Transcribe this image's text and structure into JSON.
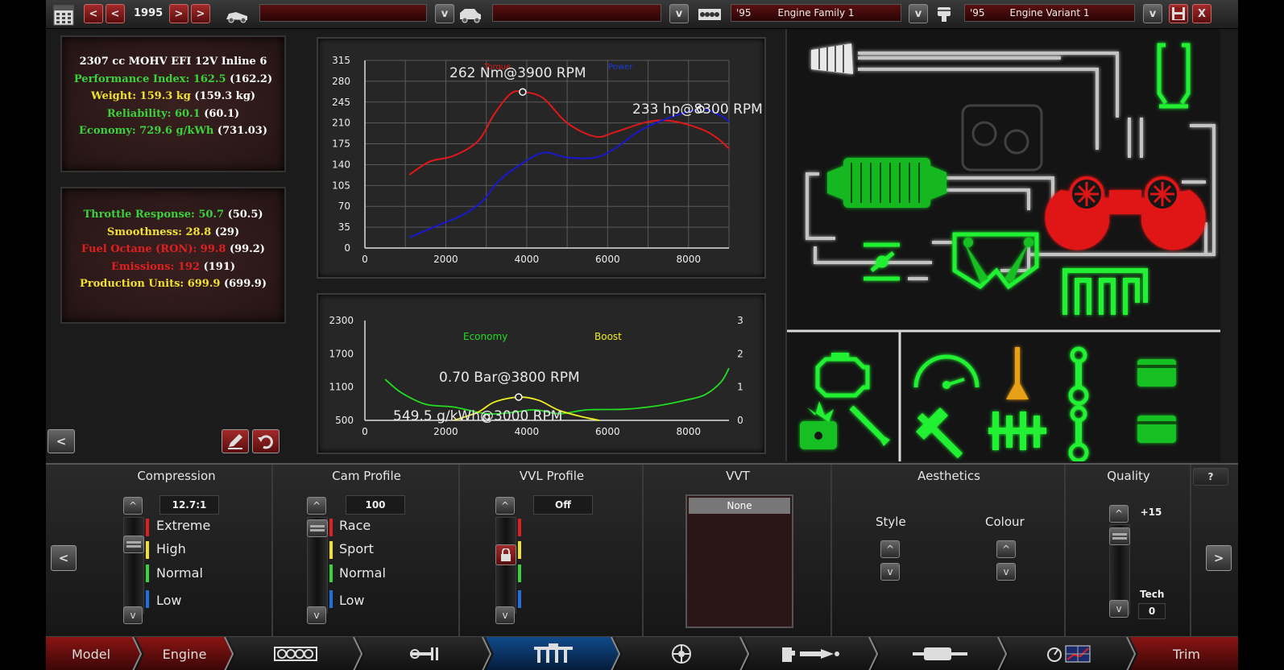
{
  "topbar": {
    "year": "1995",
    "prev_fast": "<",
    "prev": "<",
    "next": ">",
    "next_fast": ">",
    "dropdown_arrow": "v",
    "family": {
      "year": "'95",
      "name": "Engine Family 1"
    },
    "variant": {
      "year": "'95",
      "name": "Engine Variant 1"
    },
    "close": "X"
  },
  "stats_top": {
    "engine": "2307 cc MOHV EFI 12V Inline 6",
    "lines": [
      {
        "label": "Performance Index: 162.5",
        "paren": "(162.2)",
        "color": "#3cd23c"
      },
      {
        "label": "Weight: 159.3 kg",
        "paren": "(159.3 kg)",
        "color": "#f0e030"
      },
      {
        "label": "Reliability: 60.1",
        "paren": "(60.1)",
        "color": "#3cd23c"
      },
      {
        "label": "Economy: 729.6 g/kWh",
        "paren": "(731.03)",
        "color": "#3cd23c"
      }
    ]
  },
  "stats_bottom": {
    "lines": [
      {
        "label": "Throttle Response: 50.7",
        "paren": "(50.5)",
        "color": "#3cd23c"
      },
      {
        "label": "Smoothness: 28.8",
        "paren": "(29)",
        "color": "#f0e030"
      },
      {
        "label": "Fuel Octane (RON): 99.8",
        "paren": "(99.2)",
        "color": "#e02020"
      },
      {
        "label": "Emissions: 192",
        "paren": "(191)",
        "color": "#e02020"
      },
      {
        "label": "Production Units: 699.9",
        "paren": "(699.9)",
        "color": "#f0e030"
      }
    ]
  },
  "left_buttons": {
    "back": "<"
  },
  "chart_data": [
    {
      "type": "line",
      "legend": [
        "Torque",
        "Power"
      ],
      "annotations": [
        "262 Nm@3900 RPM",
        "233 hp@8300 RPM"
      ],
      "x_ticks": [
        "0",
        "2000",
        "4000",
        "6000",
        "8000"
      ],
      "y_ticks": [
        "0",
        "35",
        "70",
        "105",
        "140",
        "175",
        "210",
        "245",
        "280",
        "315"
      ],
      "xlim": [
        0,
        9000
      ],
      "ylim": [
        0,
        315
      ],
      "grid": true,
      "series": [
        {
          "name": "Torque",
          "color": "#e01818",
          "points": [
            [
              1100,
              123
            ],
            [
              1600,
              145
            ],
            [
              2200,
              155
            ],
            [
              2800,
              180
            ],
            [
              3200,
              225
            ],
            [
              3600,
              259
            ],
            [
              3900,
              262
            ],
            [
              4400,
              252
            ],
            [
              5000,
              210
            ],
            [
              5700,
              187
            ],
            [
              6200,
              195
            ],
            [
              7000,
              212
            ],
            [
              7600,
              213
            ],
            [
              8300,
              200
            ],
            [
              8700,
              185
            ],
            [
              9000,
              167
            ]
          ]
        },
        {
          "name": "Power",
          "color": "#1818d0",
          "points": [
            [
              1100,
              18
            ],
            [
              1700,
              35
            ],
            [
              2400,
              55
            ],
            [
              2900,
              78
            ],
            [
              3300,
              112
            ],
            [
              3800,
              138
            ],
            [
              4400,
              160
            ],
            [
              5000,
              152
            ],
            [
              5700,
              152
            ],
            [
              6200,
              168
            ],
            [
              6800,
              197
            ],
            [
              7500,
              218
            ],
            [
              8300,
              233
            ],
            [
              8800,
              222
            ],
            [
              9000,
              212
            ]
          ]
        }
      ]
    },
    {
      "type": "line",
      "legend": [
        "Economy",
        "Boost"
      ],
      "annotations": [
        "0.70 Bar@3800 RPM",
        "549.5 g/kWh@3000 RPM"
      ],
      "x_ticks": [
        "0",
        "2000",
        "4000",
        "6000",
        "8000"
      ],
      "y_ticks_left": [
        "500",
        "1100",
        "1700",
        "2300"
      ],
      "y_ticks_right": [
        "0",
        "1",
        "2",
        "3"
      ],
      "xlim": [
        0,
        9000
      ],
      "ylim_left": [
        500,
        2300
      ],
      "ylim_right": [
        0,
        3
      ],
      "grid": false,
      "series": [
        {
          "name": "Economy",
          "color": "#22dd22",
          "axis": "left",
          "points": [
            [
              500,
              1240
            ],
            [
              900,
              1000
            ],
            [
              1500,
              790
            ],
            [
              2200,
              740
            ],
            [
              3000,
              620
            ],
            [
              3600,
              640
            ],
            [
              4200,
              690
            ],
            [
              4800,
              620
            ],
            [
              5500,
              690
            ],
            [
              6400,
              700
            ],
            [
              7200,
              760
            ],
            [
              7900,
              860
            ],
            [
              8400,
              960
            ],
            [
              8800,
              1190
            ],
            [
              9000,
              1440
            ]
          ]
        },
        {
          "name": "Boost",
          "color": "#eeee22",
          "axis": "right",
          "points": [
            [
              2200,
              0.0
            ],
            [
              2800,
              0.25
            ],
            [
              3200,
              0.55
            ],
            [
              3800,
              0.7
            ],
            [
              4300,
              0.6
            ],
            [
              4800,
              0.3
            ],
            [
              5400,
              0.1
            ],
            [
              5800,
              0.0
            ]
          ]
        }
      ]
    }
  ],
  "bottom": {
    "compression": {
      "title": "Compression",
      "value": "12.7:1",
      "up": "^",
      "down": "v",
      "levels": [
        "Extreme",
        "High",
        "Normal",
        "Low"
      ],
      "level_colors": [
        "#e02020",
        "#f0e030",
        "#3cd23c",
        "#2070e0"
      ]
    },
    "cam": {
      "title": "Cam Profile",
      "value": "100",
      "up": "^",
      "down": "v",
      "levels": [
        "Race",
        "Sport",
        "Normal",
        "Low"
      ]
    },
    "vvl": {
      "title": "VVL Profile",
      "value": "Off",
      "up": "^",
      "down": "v"
    },
    "vvt": {
      "title": "VVT",
      "selected": "None"
    },
    "aesthetics": {
      "title": "Aesthetics",
      "style": "Style",
      "colour": "Colour",
      "up": "^",
      "down": "v"
    },
    "quality": {
      "title": "Quality",
      "value": "+15",
      "tech_label": "Tech",
      "tech_value": "0",
      "up": "^",
      "down": "v"
    },
    "help": "?",
    "prev": "<",
    "next": ">"
  },
  "nav": {
    "model": "Model",
    "engine": "Engine",
    "trim": "Trim"
  }
}
